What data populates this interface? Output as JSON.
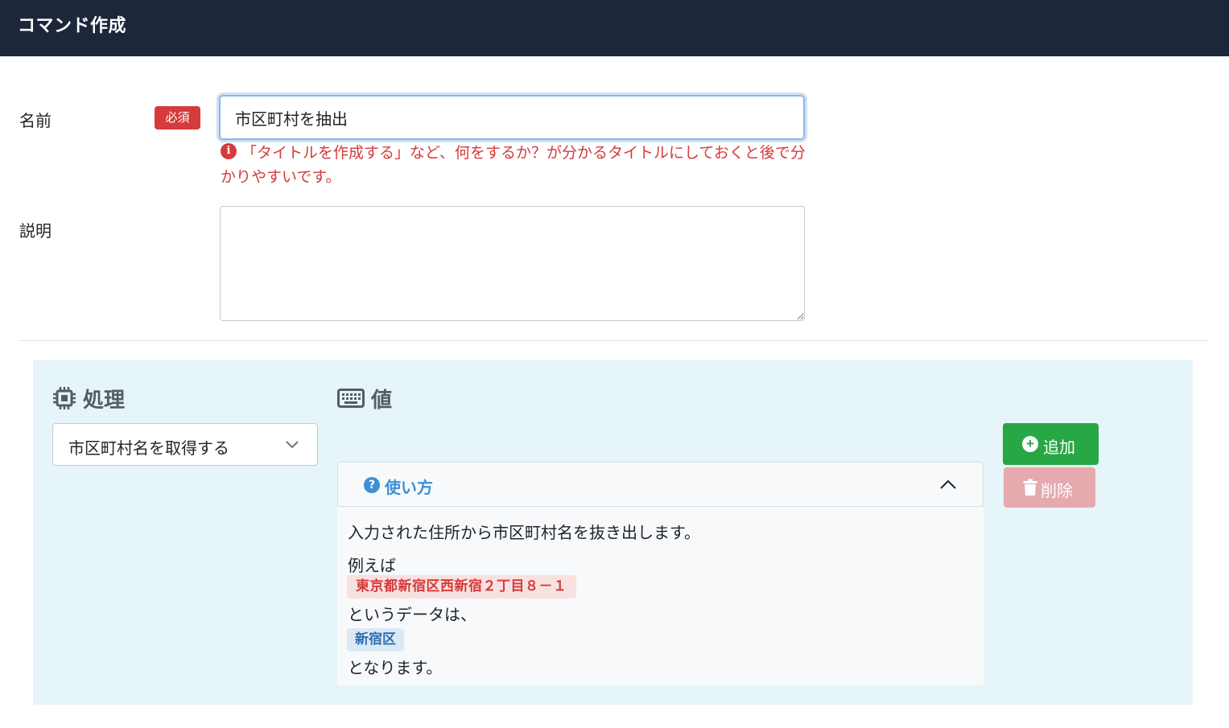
{
  "header": {
    "title": "コマンド作成"
  },
  "form": {
    "name_label": "名前",
    "required_badge": "必須",
    "name_value": "市区町村を抽出",
    "name_hint": "「タイトルを作成する」など、何をするか？が分かるタイトルにしておくと後で分かりやすいです。",
    "description_label": "説明",
    "description_value": ""
  },
  "panel": {
    "process_heading": "処理",
    "value_heading": "値",
    "process_select": "市区町村名を取得する",
    "usage": {
      "title": "使い方",
      "line1": "入力された住所から市区町村名を抜き出します。",
      "line2": "例えば",
      "example_input": "東京都新宿区西新宿２丁目８－１",
      "line3": "というデータは、",
      "example_output": "新宿区",
      "line4": "となります。"
    },
    "add_button": "追加",
    "delete_button": "削除"
  },
  "icons": {
    "process": "cpu-chip-icon",
    "value": "keyboard-icon",
    "hint": "info-icon",
    "usage": "question-icon",
    "add": "plus-circle-icon",
    "delete": "trash-icon"
  },
  "colors": {
    "topbar": "#1c273c",
    "required": "#d63a3a",
    "panel": "#e5f5f9",
    "add": "#28a745",
    "delete_disabled": "#e5a9ae",
    "link": "#3d8fd6"
  }
}
